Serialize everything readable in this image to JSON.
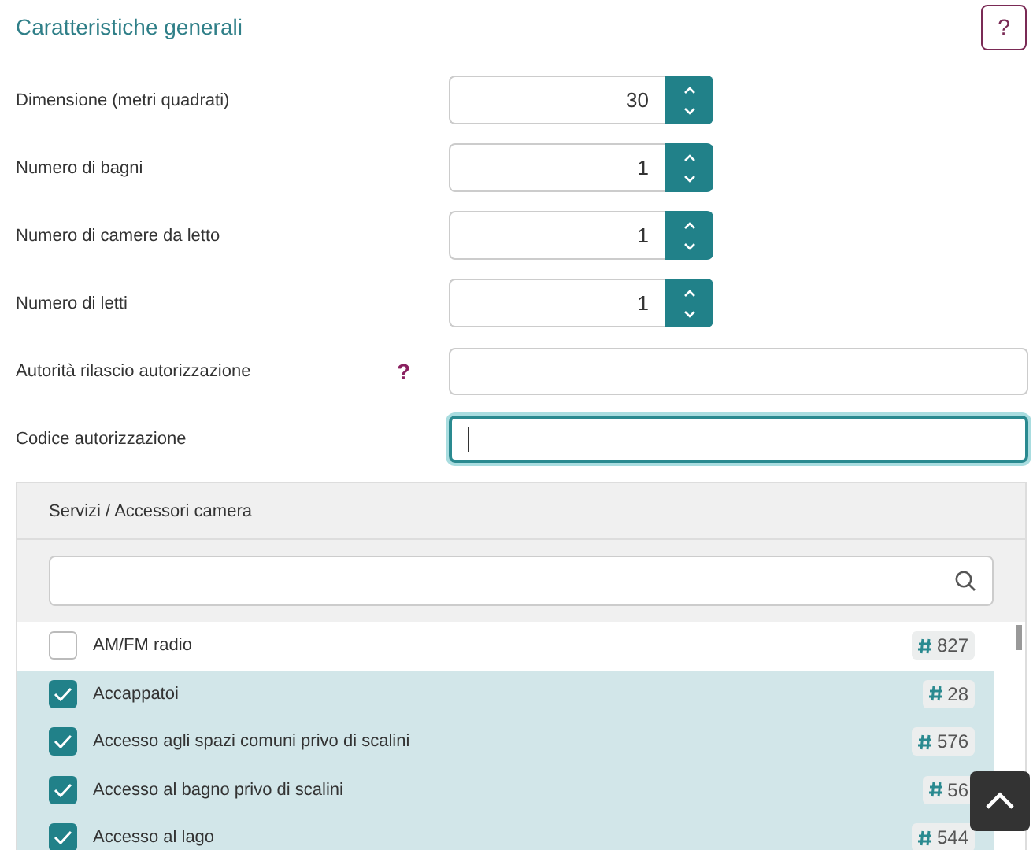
{
  "section_title": "Caratteristiche generali",
  "help_button": "?",
  "fields": [
    {
      "kind": "spinner",
      "label": "Dimensione (metri quadrati)",
      "value": "30"
    },
    {
      "kind": "spinner",
      "label": "Numero di bagni",
      "value": "1"
    },
    {
      "kind": "spinner",
      "label": "Numero di camere da letto",
      "value": "1"
    },
    {
      "kind": "spinner",
      "label": "Numero di letti",
      "value": "1"
    },
    {
      "kind": "text",
      "label": "Autorità rilascio autorizzazione",
      "hint": "?",
      "focused": false
    },
    {
      "kind": "text",
      "label": "Codice autorizzazione",
      "focused": true
    }
  ],
  "services": {
    "title": "Servizi / Accessori camera",
    "items": [
      {
        "label": "AM/FM radio",
        "checked": false,
        "count": "827"
      },
      {
        "label": "Accappatoi",
        "checked": true,
        "count": "28"
      },
      {
        "label": "Accesso agli spazi comuni privo di scalini",
        "checked": true,
        "count": "576"
      },
      {
        "label": "Accesso al bagno privo di scalini",
        "checked": true,
        "count": "56"
      },
      {
        "label": "Accesso al lago",
        "checked": true,
        "count": "544"
      }
    ]
  }
}
